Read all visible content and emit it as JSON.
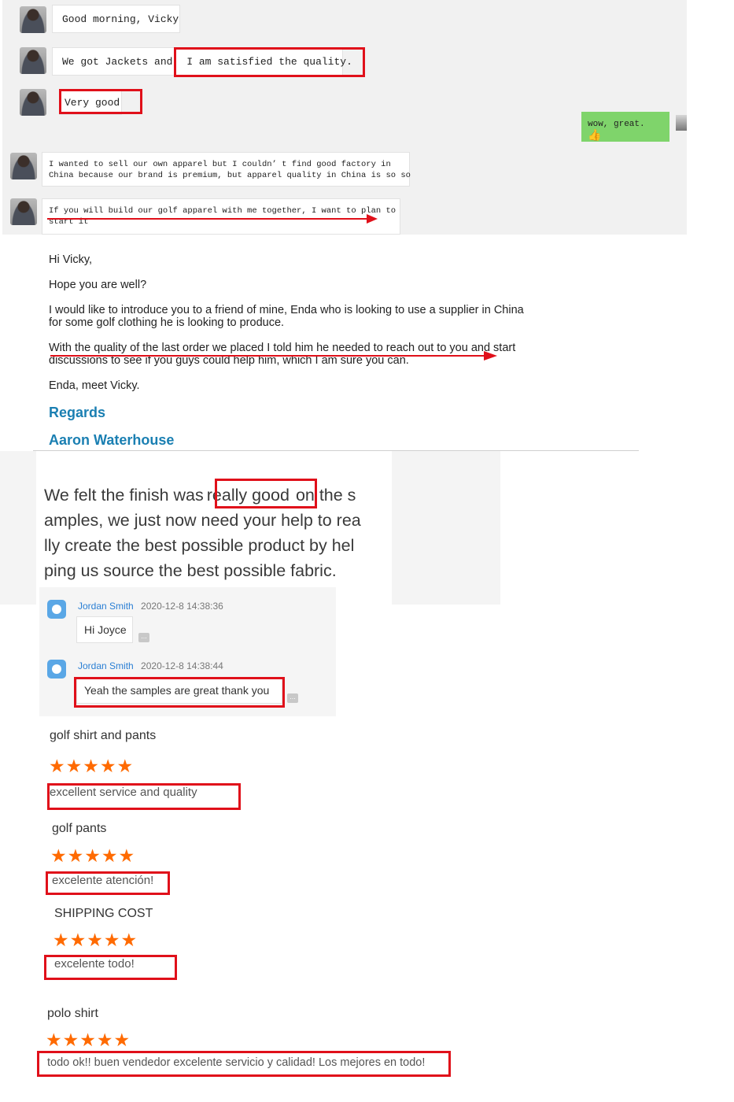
{
  "chat1": {
    "messages": [
      {
        "text": "Good morning, Vicky"
      },
      {
        "text_a": "We got Jackets and",
        "text_b": "I am satisfied the quality."
      },
      {
        "text": "Very good"
      }
    ],
    "reply": {
      "text": "wow, great.",
      "icon": "thumbs-up-icon"
    },
    "messages2": [
      {
        "line1": "I wanted to sell our own apparel but I couldn’ t find good factory in",
        "line2": "China because our brand is premium, but apparel quality in China is so so"
      },
      {
        "line1": "If you will build our golf apparel with me together, I want to plan to",
        "line2": "start it"
      }
    ]
  },
  "email": {
    "greeting": "Hi Vicky,",
    "p1": "Hope you are well?",
    "p2_line1": "I would like to introduce you to a friend of mine, Enda who is looking to use a supplier in China",
    "p2_line2": "for some golf clothing he is looking to produce.",
    "p3_line1": "With the quality of the last order we placed I told him he needed to reach out to you and start",
    "p3_line2": "discussions to see if you guys could help him, which I am sure you can.",
    "p4": "Enda, meet Vicky.",
    "regards": "Regards",
    "signature": "Aaron Waterhouse",
    "accent_color": "#1a7fb2"
  },
  "quote": {
    "part1": "We felt the finish was",
    "highlight": "really good",
    "part2": "on the s",
    "line2": "amples, we just now need your help to rea",
    "line3": "lly create the best possible product by hel",
    "line4": "ping us source the best possible fabric."
  },
  "qq_chat": [
    {
      "name": "Jordan Smith",
      "time": "2020-12-8 14:38:36",
      "text": "Hi Joyce"
    },
    {
      "name": "Jordan Smith",
      "time": "2020-12-8 14:38:44",
      "text": "Yeah the samples are great thank you"
    }
  ],
  "reviews": [
    {
      "title": "golf shirt and pants",
      "stars": 5,
      "text": "excellent service and quality"
    },
    {
      "title": "golf pants",
      "stars": 5,
      "text": "excelente atención!"
    },
    {
      "title": "SHIPPING COST",
      "stars": 5,
      "text": "excelente todo!"
    },
    {
      "title": "polo shirt",
      "stars": 5,
      "text": "todo ok!! buen vendedor excelente servicio y calidad! Los mejores en todo!"
    }
  ],
  "colors": {
    "highlight_red": "#e0101a",
    "star_orange": "#ff6a00",
    "reply_green": "#7fd46b",
    "qq_name": "#2a7fd4"
  }
}
